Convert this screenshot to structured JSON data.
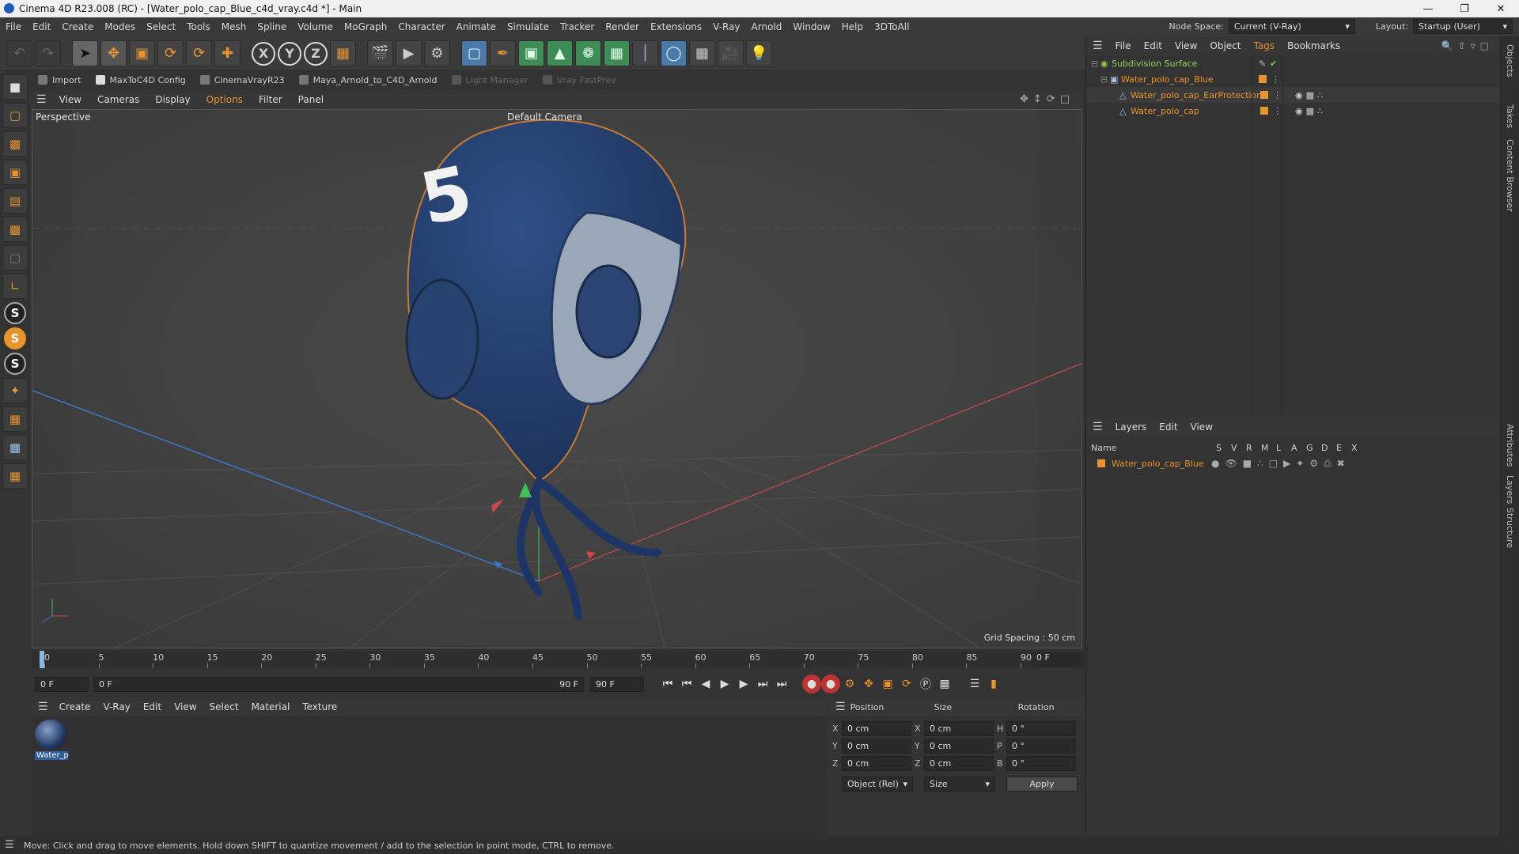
{
  "window": {
    "title": "Cinema 4D R23.008 (RC) - [Water_polo_cap_Blue_c4d_vray.c4d *] - Main"
  },
  "menu": {
    "items": [
      "File",
      "Edit",
      "Create",
      "Modes",
      "Select",
      "Tools",
      "Mesh",
      "Spline",
      "Volume",
      "MoGraph",
      "Character",
      "Animate",
      "Simulate",
      "Tracker",
      "Render",
      "Extensions",
      "V-Ray",
      "Arnold",
      "Window",
      "Help",
      "3DToAll"
    ],
    "node_space_label": "Node Space:",
    "node_space_value": "Current (V-Ray)",
    "layout_label": "Layout:",
    "layout_value": "Startup (User)"
  },
  "plugins": {
    "import": "Import",
    "maxtoc4d": "MaxToC4D Config",
    "cinemavray": "CinemaVrayR23",
    "maya_arnold": "Maya_Arnold_to_C4D_Arnold",
    "light_manager": "Light Manager",
    "vray_fastprev": "Vray FastPrev"
  },
  "viewport": {
    "menu": [
      "View",
      "Cameras",
      "Display",
      "Options",
      "Filter",
      "Panel"
    ],
    "label": "Perspective",
    "camera": "Default Camera",
    "grid_spacing": "Grid Spacing : 50 cm",
    "cap_number": "5"
  },
  "timeline": {
    "ticks": [
      "0",
      "5",
      "10",
      "15",
      "20",
      "25",
      "30",
      "35",
      "40",
      "45",
      "50",
      "55",
      "60",
      "65",
      "70",
      "75",
      "80",
      "85",
      "90"
    ],
    "end_field": "0 F",
    "start_frame": "0 F",
    "range_start": "0 F",
    "range_end": "90 F",
    "max_frame": "90 F"
  },
  "material": {
    "menu": [
      "Create",
      "V-Ray",
      "Edit",
      "View",
      "Select",
      "Material",
      "Texture"
    ],
    "thumb_label": "Water_p"
  },
  "coords": {
    "position": "Position",
    "size": "Size",
    "rotation": "Rotation",
    "px": "0 cm",
    "py": "0 cm",
    "pz": "0 cm",
    "sx": "0 cm",
    "sy": "0 cm",
    "sz": "0 cm",
    "rh": "0 °",
    "rp": "0 °",
    "rb": "0 °",
    "mode_dd": "Object (Rel)",
    "size_dd": "Size",
    "apply": "Apply",
    "labels": {
      "x": "X",
      "y": "Y",
      "z": "Z",
      "h": "H",
      "p": "P",
      "b": "B"
    }
  },
  "objects": {
    "menu": [
      "File",
      "Edit",
      "View",
      "Object",
      "Tags",
      "Bookmarks"
    ],
    "tree": [
      {
        "name": "Subdivision Surface",
        "color": "#8fd35a"
      },
      {
        "name": "Water_polo_cap_Blue",
        "color": "#e8942e"
      },
      {
        "name": "Water_polo_cap_EarProtection",
        "color": "#e8942e"
      },
      {
        "name": "Water_polo_cap",
        "color": "#e8942e"
      }
    ]
  },
  "layers": {
    "menu": [
      "Layers",
      "Edit",
      "View"
    ],
    "header_name": "Name",
    "columns": [
      "S",
      "V",
      "R",
      "M",
      "L",
      "A",
      "G",
      "D",
      "E",
      "X"
    ],
    "rows": [
      {
        "name": "Water_polo_cap_Blue",
        "color": "#e8942e"
      }
    ]
  },
  "side_tabs": [
    "Objects",
    "Takes",
    "Content Browser",
    "Attributes",
    "Layers",
    "Structure"
  ],
  "status": "Move: Click and drag to move elements. Hold down SHIFT to quantize movement / add to the selection in point mode, CTRL to remove."
}
